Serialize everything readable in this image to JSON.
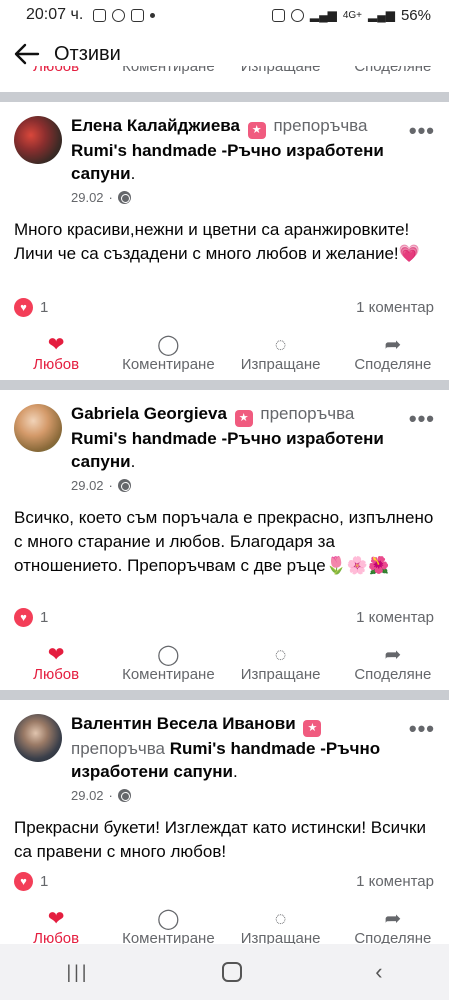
{
  "status": {
    "time": "20:07 ч.",
    "battery": "56%",
    "net": "4G+"
  },
  "appbar": {
    "title": "Отзиви"
  },
  "actions": {
    "like": "Любов",
    "comment": "Коментиране",
    "send": "Изпращане",
    "share": "Споделяне"
  },
  "posts": [
    {
      "author": "Елена Калайджиева",
      "rec": "препоръчва",
      "page": "Rumi's handmade -Ръчно изработени сапуни",
      "date": "29.02",
      "body": "Много красиви,нежни и цветни са аранжировките!Личи че са създадени с много любов и желание!💗",
      "reactions": "1",
      "comments": "1 коментар"
    },
    {
      "author": "Gabriela Georgieva",
      "rec": "препоръчва",
      "page": "Rumi's handmade -Ръчно изработени сапуни",
      "date": "29.02",
      "body": "Всичко, което съм поръчала е прекрасно, изпълнено с много старание и любов. Благодаря за отношението. Препоръчвам с две ръце🌷🌸🌺",
      "reactions": "1",
      "comments": "1 коментар"
    },
    {
      "author": "Валентин Весела Иванови",
      "rec": "препоръчва",
      "page": "Rumi's handmade -Ръчно изработени сапуни",
      "date": "29.02",
      "body": "Прекрасни букети! Изглеждат като истински! Всички са правени с много любов!",
      "reactions": "1",
      "comments": "1 коментар"
    }
  ]
}
